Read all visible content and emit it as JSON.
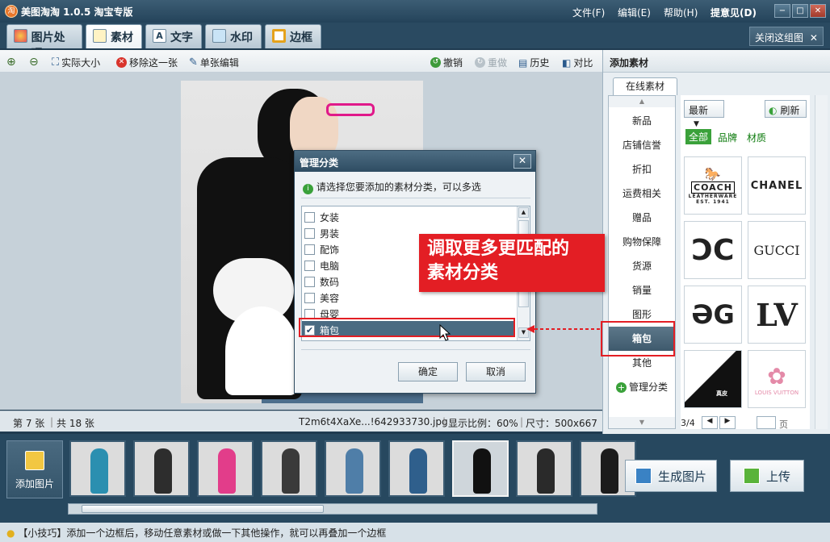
{
  "app": {
    "title": "美图淘淘 1.0.5 淘宝专版",
    "logo_text": "淘"
  },
  "menu": {
    "file": "文件(F)",
    "edit": "编辑(E)",
    "help": "帮助(H)",
    "feedback": "提意见(D)"
  },
  "window_controls": {
    "minimize": "−",
    "maximize": "□",
    "close": "✕"
  },
  "tabs": [
    {
      "label": "图片处理",
      "active": false
    },
    {
      "label": "素材",
      "active": true
    },
    {
      "label": "文字",
      "active": false
    },
    {
      "label": "水印",
      "active": false
    },
    {
      "label": "边框",
      "active": false
    }
  ],
  "close_group": "关闭这组图",
  "toolbar": {
    "actual_size": "实际大小",
    "remove_one": "移除这一张",
    "single_edit": "单张编辑",
    "undo": "撤销",
    "redo": "重做",
    "history": "历史",
    "compare": "对比"
  },
  "info": {
    "current": "第 7 张",
    "total": "共 18 张",
    "filename": "T2m6t4XaXe...!642933730.jpg",
    "scale": "显示比例：60%",
    "size": "尺寸：500x667"
  },
  "right_panel": {
    "title": "添加素材",
    "online_tab": "在线素材",
    "categories": [
      "新品",
      "店铺信誉",
      "折扣",
      "运费相关",
      "赠品",
      "购物保障",
      "货源",
      "销量",
      "图形",
      "箱包",
      "其他"
    ],
    "selected_category": "箱包",
    "manage": "管理分类",
    "sort": "最新",
    "refresh": "刷新",
    "filters": [
      "全部",
      "品牌",
      "材质"
    ],
    "logos": [
      "COACH",
      "CHANEL",
      "CC",
      "GUCCI",
      "GG",
      "LV",
      "真皮",
      "LOUIS VUITTON"
    ],
    "coach_sub": "LEATHERWARE",
    "coach_est": "EST. 1941",
    "leather_label": "真皮",
    "pager": "3/4",
    "page_suffix": "页"
  },
  "dialog": {
    "title": "管理分类",
    "info": "请选择您要添加的素材分类，可以多选",
    "options": [
      {
        "label": "女装",
        "checked": false
      },
      {
        "label": "男装",
        "checked": false
      },
      {
        "label": "配饰",
        "checked": false
      },
      {
        "label": "电脑",
        "checked": false
      },
      {
        "label": "数码",
        "checked": false
      },
      {
        "label": "美容",
        "checked": false
      },
      {
        "label": "母婴",
        "checked": false
      },
      {
        "label": "箱包",
        "checked": true
      }
    ],
    "ok": "确定",
    "cancel": "取消"
  },
  "callout": {
    "line1": "调取更多更匹配的",
    "line2": "素材分类"
  },
  "filmstrip": {
    "add": "添加图片",
    "thumbnail_count": 9,
    "selected_index": 6,
    "generate": "生成图片",
    "upload": "上传"
  },
  "tip": "【小技巧】添加一个边框后，移动任意素材或做一下其他操作，就可以再叠加一个边框",
  "colors": {
    "accent_red": "#e31e24",
    "title_bar": "#2e4c62",
    "selection": "#4a6b82"
  }
}
